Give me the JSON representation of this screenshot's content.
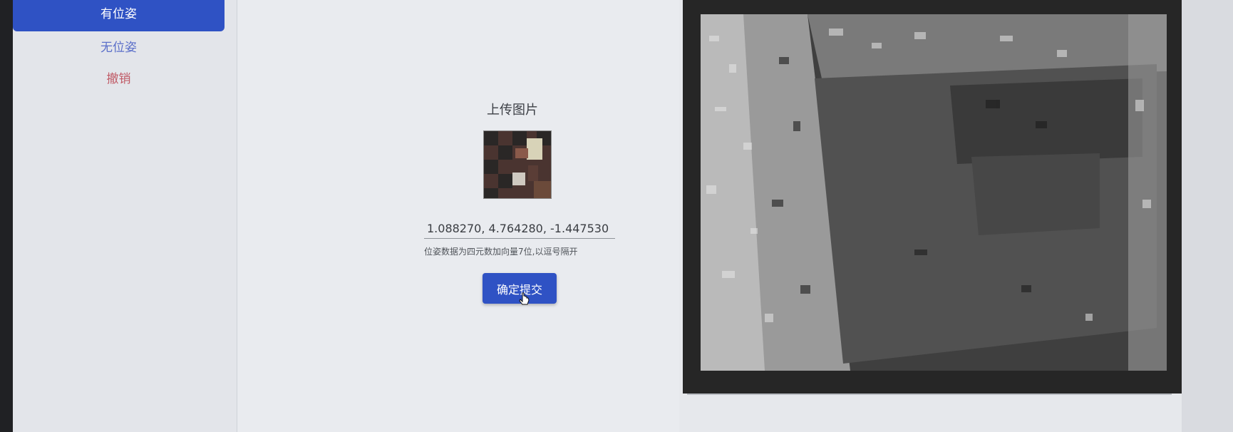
{
  "sidebar": {
    "items": [
      {
        "label": "有位姿",
        "active": true,
        "color": "#2f52c4"
      },
      {
        "label": "无位姿",
        "active": false,
        "color": "#5b6fc9"
      },
      {
        "label": "撤销",
        "active": false,
        "color": "#c05a66"
      }
    ]
  },
  "upload": {
    "title": "上传图片",
    "thumbnail_icon": "image-thumbnail"
  },
  "pose": {
    "value": "1.088270, 4.764280, -1.447530",
    "hint": "位姿数据为四元数加向量7位,以逗号隔开"
  },
  "actions": {
    "submit_label": "确定提交"
  },
  "viewer": {
    "icon": "depth-image"
  },
  "colors": {
    "accent": "#2f52c4",
    "danger": "#c05a66"
  }
}
